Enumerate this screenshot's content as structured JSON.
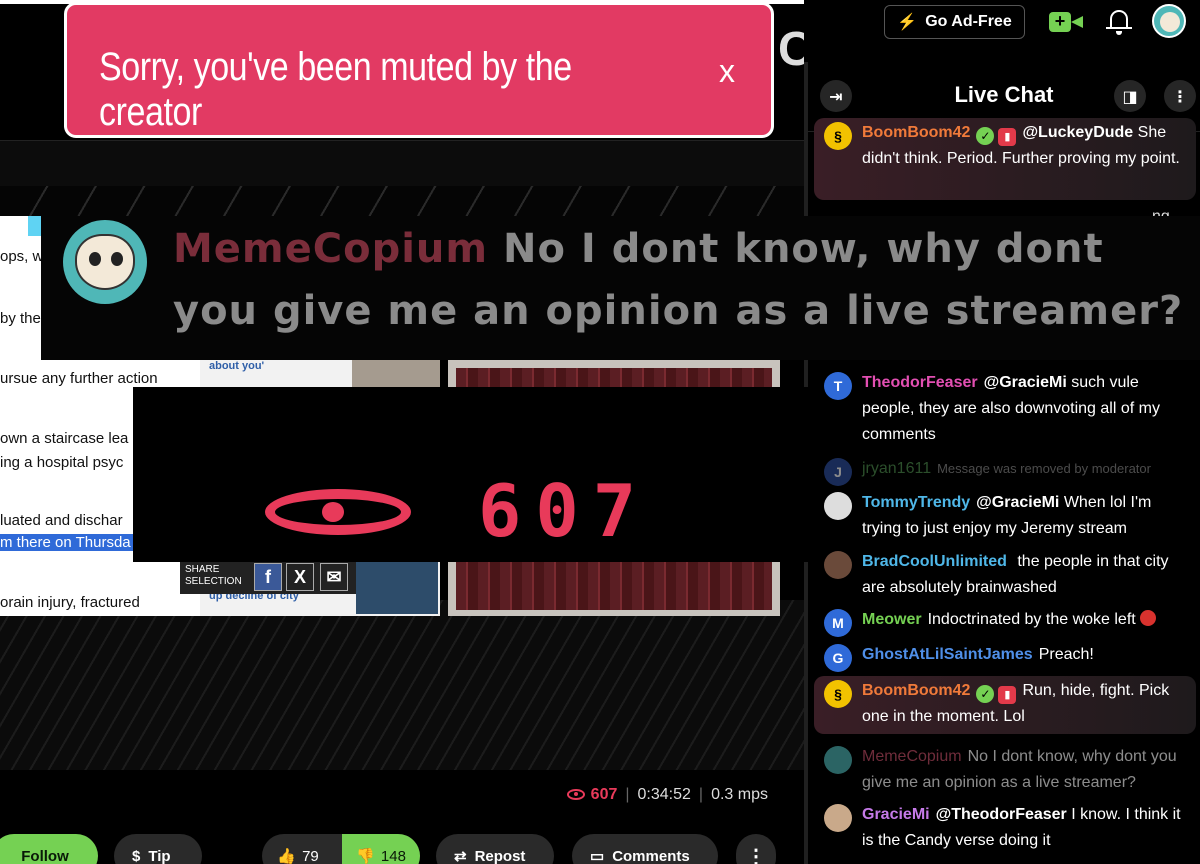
{
  "header": {
    "go_ad_free": "Go Ad-Free",
    "bolt_icon": "bolt-icon",
    "cam_icon": "video-camera-plus-icon",
    "bell_icon": "bell-icon"
  },
  "banner": {
    "text": "Sorry, you've been muted by the creator",
    "close": "x"
  },
  "video": {
    "partial_title_char": "C",
    "article_lines": [
      "ops, w",
      "by the",
      "ursue any further action",
      "own a staircase lea",
      "ing a hospital psyc",
      "luated and dischar",
      "m there on Thursda",
      "orain injury, fractured"
    ],
    "about_you": "about you'",
    "up_decline": "up decline of city",
    "share_label_1": "SHARE",
    "share_label_2": "SELECTION",
    "share_facebook": "f",
    "share_x": "X",
    "share_email": "✉"
  },
  "meme_overlay": {
    "username": "MemeCopium",
    "line1": "No I dont know, why dont",
    "line2": "you give me an opinion as a live streamer?"
  },
  "viewer_overlay": {
    "count": "607"
  },
  "stats": {
    "viewers": "607",
    "duration": "0:34:52",
    "rate": "0.3 mps"
  },
  "actions": {
    "follow": "Follow",
    "tip": "Tip",
    "likes": "79",
    "dislikes": "148",
    "repost": "Repost",
    "comments": "Comments",
    "more": "⋮"
  },
  "chat": {
    "title": "Live Chat",
    "cut_text": "ng",
    "messages": [
      {
        "user": "BoomBoom42",
        "mention": "@LuckeyDude",
        "text": "She didn't think. Period. Further proving my point.",
        "color": "#f07a3a"
      },
      {
        "user": "TheodorFeaser",
        "initial": "T",
        "mention": "@GracieMi",
        "text": "such vule people, they are also downvoting all of my comments",
        "color": "#e24fb2"
      },
      {
        "user": "jryan1611",
        "initial": "J",
        "text": "Message was removed by moderator",
        "color": "#4f8f4f"
      },
      {
        "user": "TommyTrendy",
        "mention": "@GracieMi",
        "text": "When lol I'm trying to just enjoy my Jeremy stream",
        "color": "#4fb7e8"
      },
      {
        "user": "BradCoolUnlimited",
        "text": "the people in that city are absolutely brainwashed",
        "color": "#4fb7e8"
      },
      {
        "user": "Meower",
        "initial": "M",
        "text": "Indoctrinated by the woke left",
        "color": "#75d153"
      },
      {
        "user": "GhostAtLilSaintJames",
        "initial": "G",
        "text": "Preach!",
        "color": "#4f8fe8"
      },
      {
        "user": "BoomBoom42",
        "text": "Run, hide, fight. Pick one in the moment. Lol",
        "color": "#f07a3a"
      },
      {
        "user": "MemeCopium",
        "text": "No I dont know, why dont you give me an opinion as a live streamer?",
        "color": "#c8506a"
      },
      {
        "user": "GracieMi",
        "mention": "@TheodorFeaser",
        "text": "I know. I think it is the Candy verse doing it",
        "color": "#c57ae8"
      }
    ]
  }
}
